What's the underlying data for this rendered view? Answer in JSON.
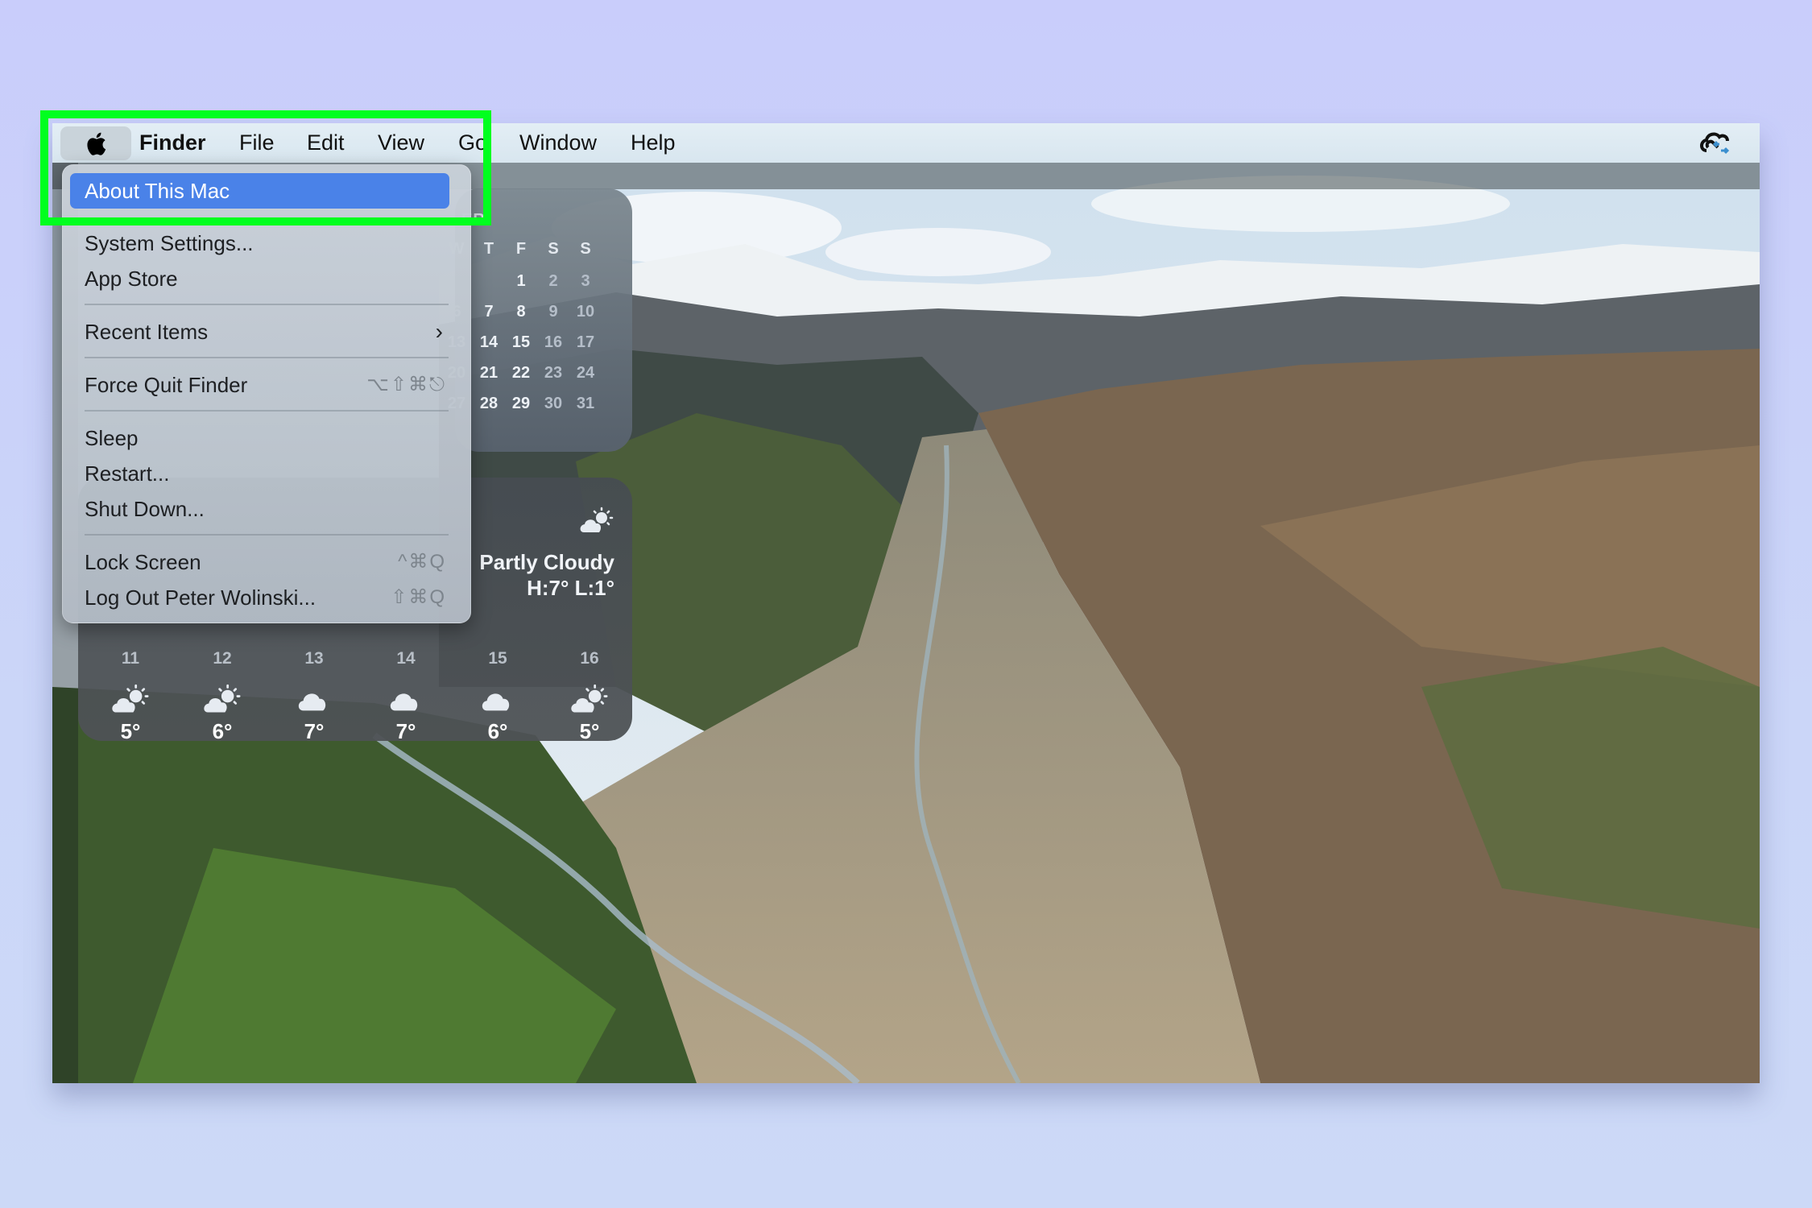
{
  "menubar": {
    "apple_menu": "apple-logo",
    "items": [
      "Finder",
      "File",
      "Edit",
      "View",
      "Go",
      "Window",
      "Help"
    ],
    "status_icons": [
      "creative-cloud-sync-icon"
    ]
  },
  "apple_menu": {
    "items": [
      {
        "label": "About This Mac",
        "shortcut": "",
        "highlighted": true
      },
      {
        "label": "System Settings...",
        "shortcut": ""
      },
      {
        "label": "App Store",
        "shortcut": ""
      },
      {
        "label": "Recent Items",
        "shortcut": "",
        "submenu": true
      },
      {
        "label": "Force Quit Finder",
        "shortcut": "⌥⇧⌘⎋"
      },
      {
        "label": "Sleep",
        "shortcut": ""
      },
      {
        "label": "Restart...",
        "shortcut": ""
      },
      {
        "label": "Shut Down...",
        "shortcut": ""
      },
      {
        "label": "Lock Screen",
        "shortcut": "^⌘Q"
      },
      {
        "label": "Log Out Peter Wolinski...",
        "shortcut": "⇧⌘Q"
      }
    ],
    "highlight_color": "#4a82e8"
  },
  "calendar_widget": {
    "month_label_visible": "ER",
    "weekday_headers": [
      "W",
      "T",
      "F",
      "S",
      "S"
    ],
    "rows": [
      [
        "",
        "",
        "1",
        "2",
        "3"
      ],
      [
        "6",
        "7",
        "8",
        "9",
        "10"
      ],
      [
        "13",
        "14",
        "15",
        "16",
        "17"
      ],
      [
        "20",
        "21",
        "22",
        "23",
        "24"
      ],
      [
        "27",
        "28",
        "29",
        "30",
        "31"
      ]
    ]
  },
  "weather_widget": {
    "condition": "Partly Cloudy",
    "high_low": "H:7° L:1°",
    "current_icon": "partly-cloudy-icon",
    "forecast": [
      {
        "hour": "11",
        "icon": "partly-cloudy",
        "temp": "5°"
      },
      {
        "hour": "12",
        "icon": "partly-cloudy",
        "temp": "6°"
      },
      {
        "hour": "13",
        "icon": "cloudy",
        "temp": "7°"
      },
      {
        "hour": "14",
        "icon": "cloudy",
        "temp": "7°"
      },
      {
        "hour": "15",
        "icon": "cloudy",
        "temp": "6°"
      },
      {
        "hour": "16",
        "icon": "partly-cloudy",
        "temp": "5°"
      }
    ]
  },
  "annotation": {
    "color": "#00ff1f",
    "target": "About This Mac"
  }
}
